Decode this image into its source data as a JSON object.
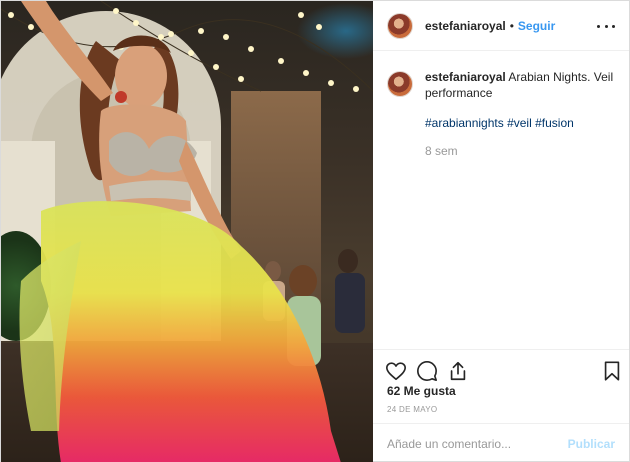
{
  "post": {
    "photo": {
      "alt": ""
    },
    "header": {
      "username": "estefaniaroyal",
      "separator": "•",
      "follow_label": "Seguir",
      "more_icon": "more-horizontal-icon"
    },
    "caption": {
      "username": "estefaniaroyal",
      "text": "Arabian Nights. Veil performance",
      "hashtags": [
        "#arabiannights",
        "#veil",
        "#fusion"
      ],
      "time_ago": "8 sem"
    },
    "actions": {
      "like_icon": "heart-icon",
      "comment_icon": "comment-icon",
      "share_icon": "share-icon",
      "save_icon": "bookmark-icon"
    },
    "likes": "62 Me gusta",
    "date": "24 DE MAYO",
    "add_comment": {
      "placeholder": "Añade un comentario...",
      "publish_label": "Publicar"
    },
    "colors": {
      "link_blue": "#3897f0",
      "hashtag_blue": "#003569",
      "muted_text": "#999999",
      "publish_disabled": "#b2dffc",
      "border": "#efefef"
    }
  }
}
